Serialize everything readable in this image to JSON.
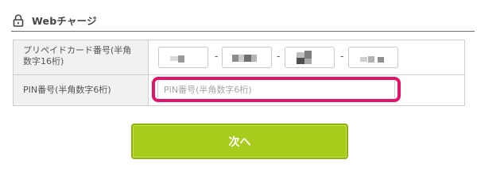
{
  "section": {
    "title": "Webチャージ",
    "icon": "lock-icon"
  },
  "form": {
    "card_number_label": "プリペイドカード番号(半角数字16桁)",
    "card_separator": "-",
    "pin_label": "PIN番号(半角数字6桁)",
    "pin_placeholder": "PIN番号(半角数字6桁)",
    "pin_value": ""
  },
  "actions": {
    "next_label": "次へ"
  },
  "colors": {
    "highlight": "#e5126a",
    "button": "#a8cc1c",
    "label_bg": "#f1f1f1"
  }
}
